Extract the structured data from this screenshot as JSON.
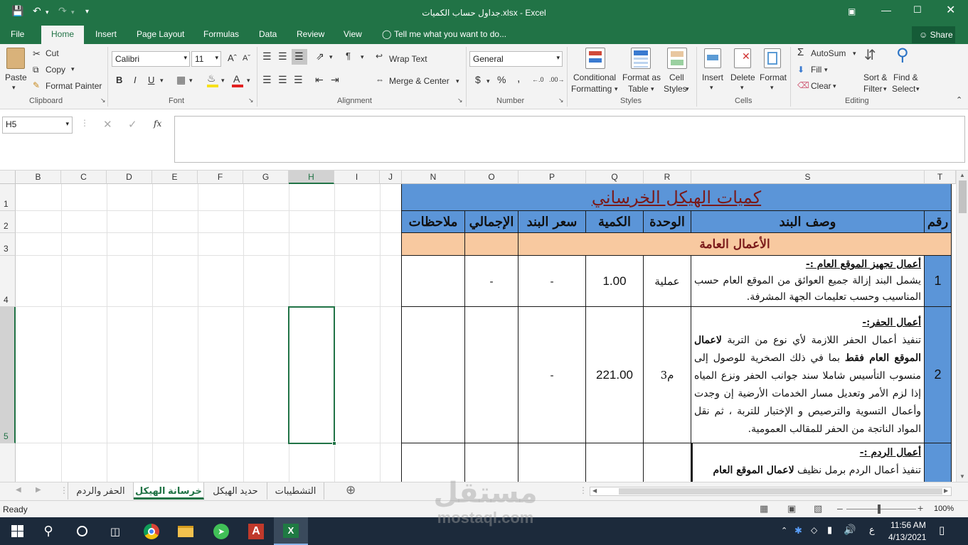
{
  "window": {
    "title": "جداول حساب الكميات.xlsx - Excel",
    "help_search": "Tell me what you want to do...",
    "share": "Share"
  },
  "tabs": [
    "File",
    "Home",
    "Insert",
    "Page Layout",
    "Formulas",
    "Data",
    "Review",
    "View"
  ],
  "ribbon": {
    "clipboard": {
      "paste": "Paste",
      "cut": "Cut",
      "copy": "Copy",
      "format_painter": "Format Painter",
      "label": "Clipboard"
    },
    "font": {
      "name": "Calibri",
      "size": "11",
      "bold": "B",
      "italic": "I",
      "underline": "U",
      "label": "Font"
    },
    "alignment": {
      "wrap": "Wrap Text",
      "merge": "Merge & Center",
      "label": "Alignment"
    },
    "number": {
      "format": "General",
      "currency": "$",
      "percent": "%",
      "comma": ",",
      "label": "Number"
    },
    "styles": {
      "conditional": "Conditional",
      "conditional2": "Formatting",
      "format_table": "Format as",
      "format_table2": "Table",
      "cell_styles": "Cell",
      "cell_styles2": "Styles",
      "label": "Styles"
    },
    "cells": {
      "insert": "Insert",
      "delete": "Delete",
      "format": "Format",
      "label": "Cells"
    },
    "editing": {
      "autosum": "AutoSum",
      "fill": "Fill",
      "clear": "Clear",
      "sort": "Sort &",
      "sort2": "Filter",
      "find": "Find &",
      "find2": "Select",
      "label": "Editing"
    }
  },
  "formula_bar": {
    "name_box": "H5",
    "fx": "fx",
    "value": ""
  },
  "columns": [
    "B",
    "C",
    "D",
    "E",
    "F",
    "G",
    "H",
    "I",
    "J",
    "N",
    "O",
    "P",
    "Q",
    "R",
    "S",
    "T"
  ],
  "rows": [
    "1",
    "2",
    "3",
    "4",
    "5"
  ],
  "sheet": {
    "title": "كميات الهيكل الخرساني",
    "headers": {
      "num": "رقم",
      "desc": "وصف البند",
      "unit": "الوحدة",
      "qty": "الكمية",
      "price": "سعر البند",
      "total": "الإجمالي",
      "notes": "ملاحظات"
    },
    "section": "الأعمال العامة",
    "items": [
      {
        "num": "1",
        "heading": "أعمال تجهيز الموقع العام :-",
        "body": "يشمل البند إزالة جميع العوائق من الموقع العام حسب المناسيب وحسب تعليمات الجهة المشرفة.",
        "unit": "عملية",
        "qty": "1.00",
        "price": "-",
        "total": "-"
      },
      {
        "num": "2",
        "heading": "أعمال الحفر:-",
        "body_pre": "تنفيذ أعمال الحفر اللازمة لأي نوع من التربة ",
        "body_bold": "لاعمال الموقع العام فقط",
        "body_post": " بما في ذلك الصخرية للوصول إلى منسوب التأسيس شاملا سند جوانب الحفر ونزع المياه إذا لزم الأمر وتعديل مسار الخدمات الأرضية إن وجدت وأعمال التسوية والترصيص و الإختبار للتربة ، ثم نقل المواد الناتجة من الحفر للمقالب العمومية.",
        "unit": "م3",
        "qty": "221.00",
        "price": "-",
        "total": ""
      },
      {
        "num": "",
        "heading": "أعمال الردم :-",
        "body_pre": "تنفيذ أعمال الردم برمل نظيف ",
        "body_bold": "لاعمال الموقع العام",
        "body_post": "",
        "unit": "",
        "qty": "",
        "price": "",
        "total": ""
      }
    ]
  },
  "sheet_tabs": [
    "الحفر والردم",
    "خرسانة الهيكل",
    "حديد الهيكل",
    "التشطيبات"
  ],
  "status": {
    "ready": "Ready",
    "zoom": "100%"
  },
  "taskbar": {
    "time": "11:56 AM",
    "date": "4/13/2021",
    "lang": "ع"
  },
  "watermark": {
    "arabic": "مستقل",
    "latin": "mostaql.com"
  }
}
